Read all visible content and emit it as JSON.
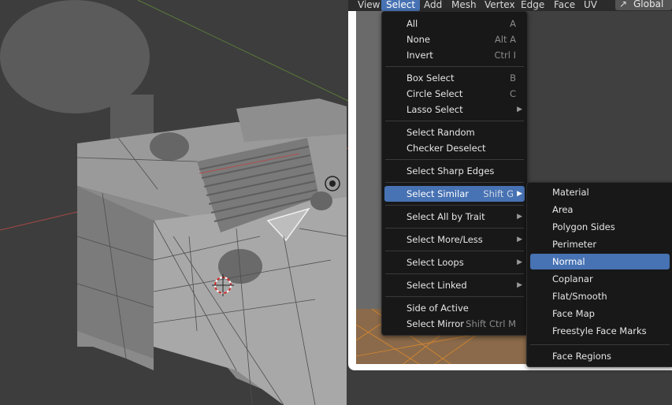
{
  "menubar": {
    "items": [
      "View",
      "Select",
      "Add",
      "Mesh",
      "Vertex",
      "Edge",
      "Face",
      "UV"
    ],
    "active_index": 1,
    "orientation": "Global",
    "orientation_icon": "transform-orientation-icon"
  },
  "select_menu": {
    "groups": [
      [
        {
          "label": "All",
          "shortcut": "A",
          "submenu": false
        },
        {
          "label": "None",
          "shortcut": "Alt A",
          "submenu": false
        },
        {
          "label": "Invert",
          "shortcut": "Ctrl I",
          "submenu": false
        }
      ],
      [
        {
          "label": "Box Select",
          "shortcut": "B",
          "submenu": false
        },
        {
          "label": "Circle Select",
          "shortcut": "C",
          "submenu": false
        },
        {
          "label": "Lasso Select",
          "shortcut": "",
          "submenu": true
        }
      ],
      [
        {
          "label": "Select Random",
          "shortcut": "",
          "submenu": false
        },
        {
          "label": "Checker Deselect",
          "shortcut": "",
          "submenu": false
        }
      ],
      [
        {
          "label": "Select Sharp Edges",
          "shortcut": "",
          "submenu": false
        }
      ],
      [
        {
          "label": "Select Similar",
          "shortcut": "Shift G",
          "submenu": true,
          "highlighted": true
        }
      ],
      [
        {
          "label": "Select All by Trait",
          "shortcut": "",
          "submenu": true
        }
      ],
      [
        {
          "label": "Select More/Less",
          "shortcut": "",
          "submenu": true
        }
      ],
      [
        {
          "label": "Select Loops",
          "shortcut": "",
          "submenu": true
        }
      ],
      [
        {
          "label": "Select Linked",
          "shortcut": "",
          "submenu": true
        }
      ],
      [
        {
          "label": "Side of Active",
          "shortcut": "",
          "submenu": false
        },
        {
          "label": "Select Mirror",
          "shortcut": "Shift Ctrl M",
          "submenu": false
        }
      ]
    ]
  },
  "similar_menu": {
    "items": [
      "Material",
      "Area",
      "Polygon Sides",
      "Perimeter",
      "Normal",
      "Coplanar",
      "Flat/Smooth",
      "Face Map",
      "Freestyle Face Marks"
    ],
    "highlighted_index": 4,
    "footer_item": "Face Regions"
  },
  "colors": {
    "highlight": "#4772b3",
    "menu_bg": "#181818",
    "viewport_bg": "#3d3d3d"
  }
}
